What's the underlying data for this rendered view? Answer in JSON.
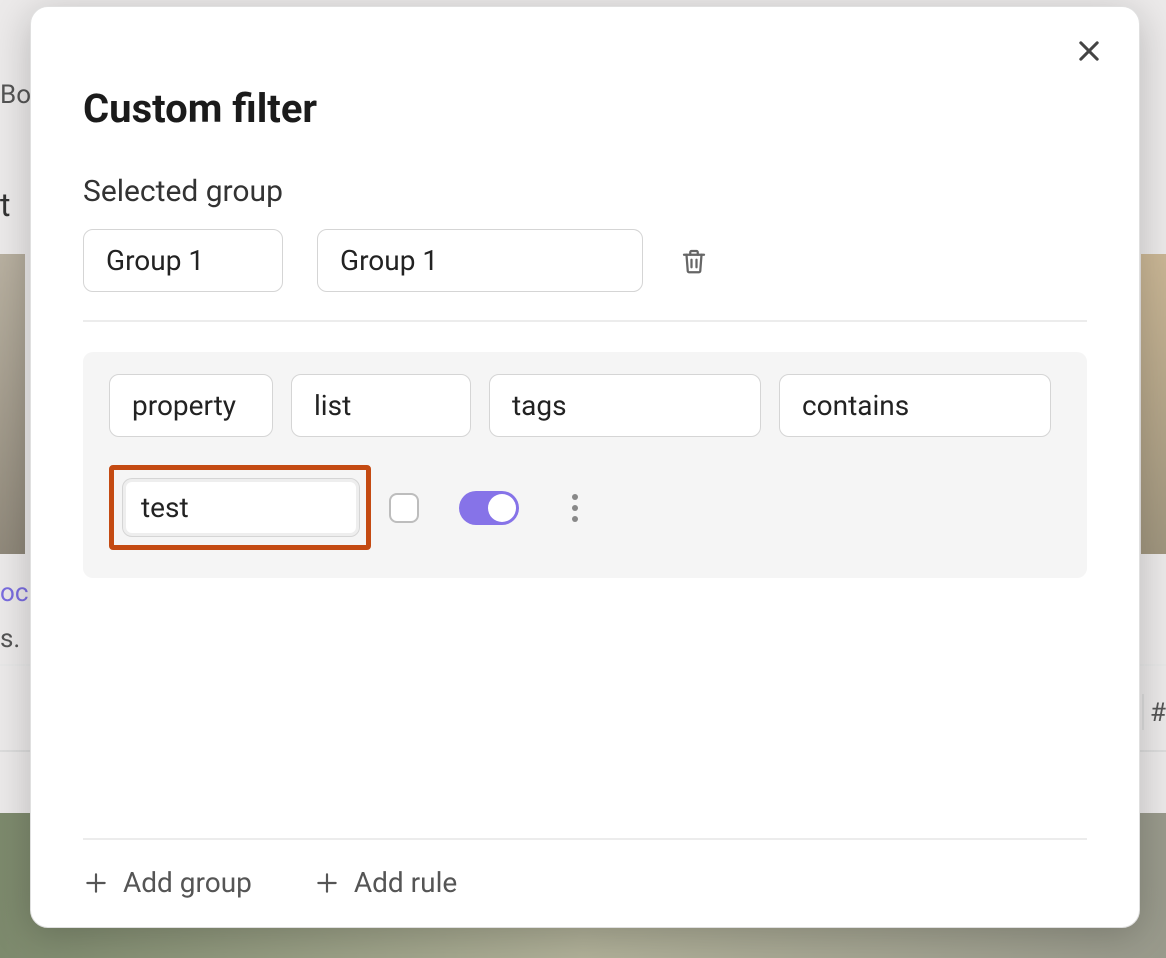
{
  "background": {
    "partial_bo": "Bo",
    "partial_t": "t",
    "partial_link": "oc",
    "partial_s": "s.",
    "hash": "#"
  },
  "modal": {
    "title": "Custom filter",
    "selected_group_label": "Selected group",
    "groups": {
      "chip1": "Group 1",
      "chip2": "Group 1"
    },
    "rule": {
      "field_type": "property",
      "property_type": "list",
      "property_name": "tags",
      "operator": "contains",
      "value": "test"
    },
    "footer": {
      "add_group": "Add group",
      "add_rule": "Add rule"
    }
  }
}
